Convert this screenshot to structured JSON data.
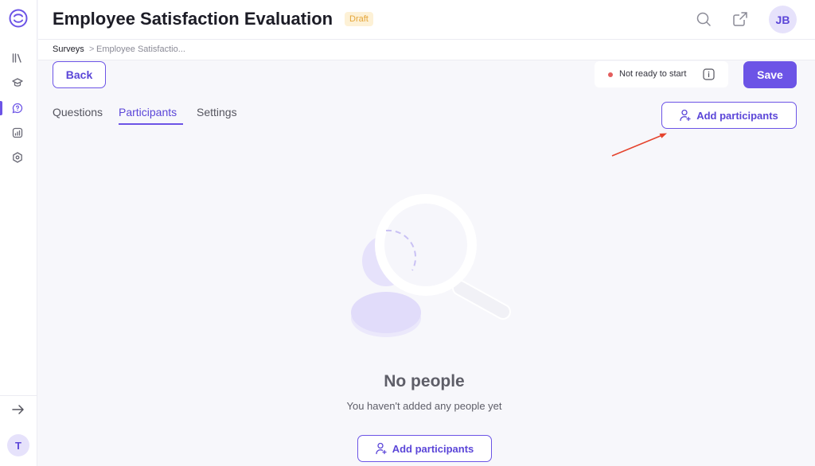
{
  "sidebar": {
    "items": [
      {
        "icon": "library-icon"
      },
      {
        "icon": "graduation-cap-icon"
      },
      {
        "icon": "survey-chat-icon",
        "active": true
      },
      {
        "icon": "analytics-icon"
      },
      {
        "icon": "settings-hexagon-icon"
      }
    ],
    "collapse_icon": "arrow-right-icon",
    "user_initial": "T"
  },
  "header": {
    "title": "Employee Satisfaction Evaluation",
    "status_badge": "Draft",
    "user_initials": "JB"
  },
  "breadcrumb": {
    "root": "Surveys",
    "separator": ">",
    "current": "Employee Satisfactio..."
  },
  "actions": {
    "back_label": "Back",
    "readiness_status": "Not ready to start",
    "save_label": "Save"
  },
  "tabs": [
    {
      "label": "Questions",
      "active": false
    },
    {
      "label": "Participants",
      "active": true
    },
    {
      "label": "Settings",
      "active": false
    }
  ],
  "participants": {
    "add_button_label": "Add participants",
    "empty_title": "No people",
    "empty_subtitle": "You haven't added any people yet",
    "empty_add_button_label": "Add participants"
  },
  "colors": {
    "accent": "#6c54e6",
    "draft_badge_bg": "#fdf1d6",
    "draft_badge_text": "#e5a63a",
    "status_dot": "#e35d5d",
    "annotation_arrow": "#e5432d"
  }
}
